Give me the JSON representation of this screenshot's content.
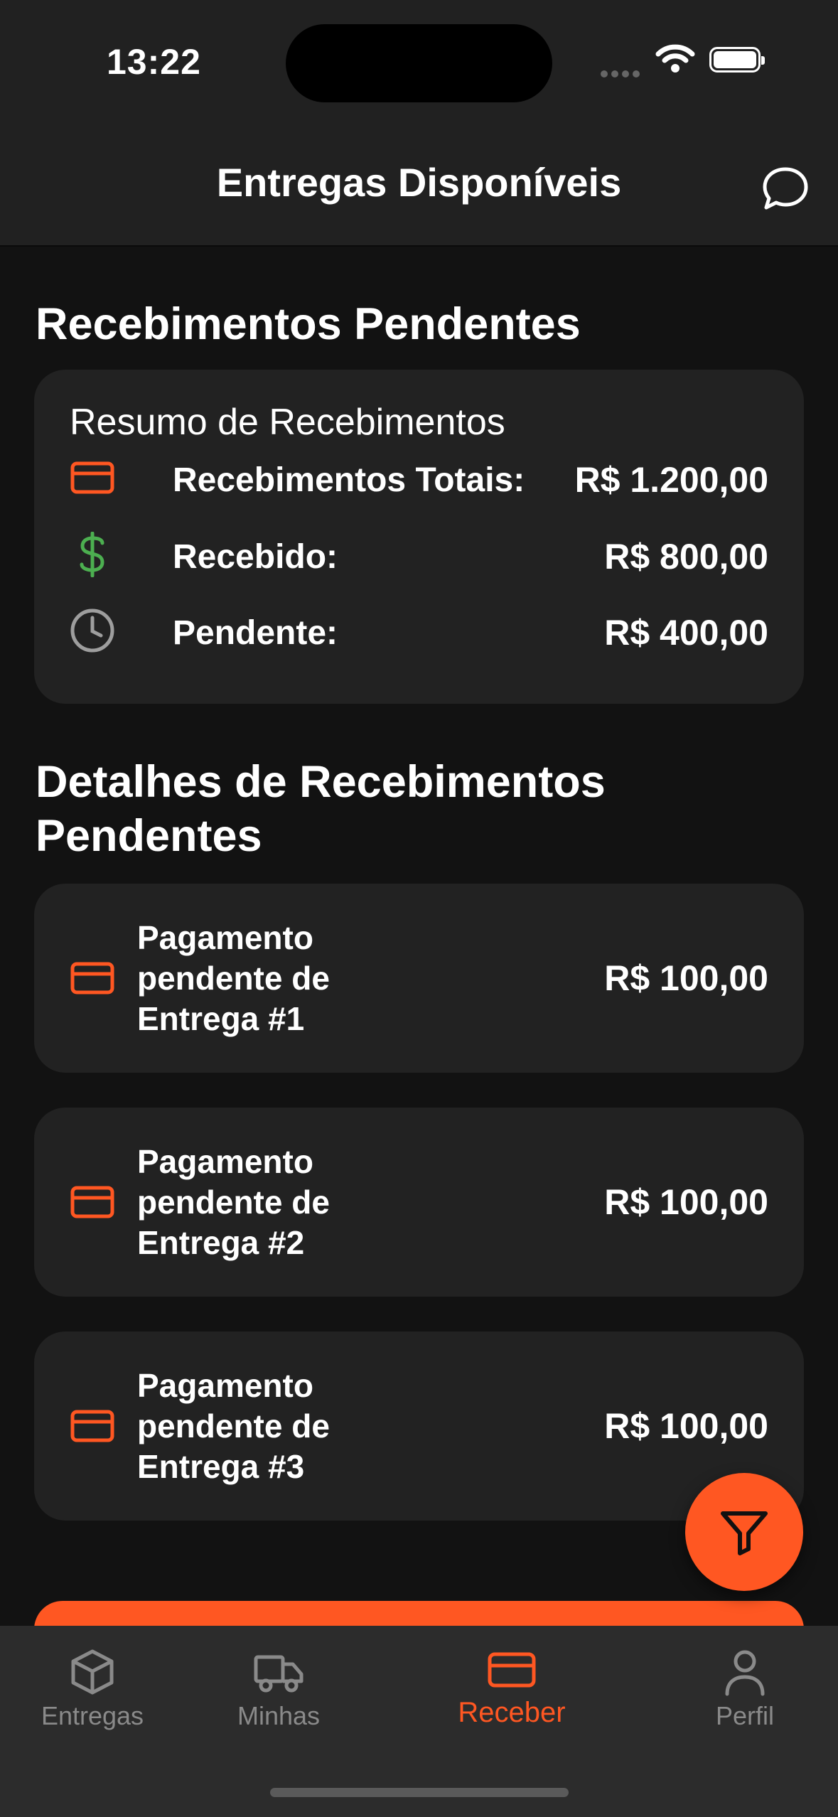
{
  "status_bar": {
    "time": "13:22"
  },
  "header": {
    "title": "Entregas Disponíveis",
    "chat_icon": "chat-bubble-icon"
  },
  "summary_section": {
    "title": "Recebimentos Pendentes",
    "card_title": "Resumo de Recebimentos",
    "rows": [
      {
        "label": "Recebimentos Totais:",
        "value": "R$ 1.200,00",
        "icon": "credit-card-icon",
        "color": "#FF5722"
      },
      {
        "label": "Recebido:",
        "value": "R$ 800,00",
        "icon": "dollar-sign-icon",
        "color": "#4CAF50"
      },
      {
        "label": "Pendente:",
        "value": "R$ 400,00",
        "icon": "clock-icon",
        "color": "#9E9E9E"
      }
    ]
  },
  "details_section": {
    "title": "Detalhes de Recebimentos Pendentes",
    "items": [
      {
        "line1": "Pagamento",
        "line2": "pendente de",
        "line3": "Entrega #1",
        "value": "R$ 100,00"
      },
      {
        "line1": "Pagamento",
        "line2": "pendente de",
        "line3": "Entrega #2",
        "value": "R$ 100,00"
      },
      {
        "line1": "Pagamento",
        "line2": "pendente de",
        "line3": "Entrega #3",
        "value": "R$ 100,00"
      }
    ]
  },
  "fab": {
    "icon": "filter-icon"
  },
  "tabbar": {
    "tabs": [
      {
        "label": "Entregas",
        "icon": "box-icon",
        "active": false
      },
      {
        "label": "Minhas",
        "icon": "truck-icon",
        "active": false
      },
      {
        "label": "Receber",
        "icon": "credit-card-icon",
        "active": true
      },
      {
        "label": "Perfil",
        "icon": "user-icon",
        "active": false
      }
    ]
  },
  "colors": {
    "accent": "#FF5722",
    "success": "#4CAF50",
    "muted": "#9E9E9E",
    "background": "#121212",
    "card": "#222222"
  }
}
